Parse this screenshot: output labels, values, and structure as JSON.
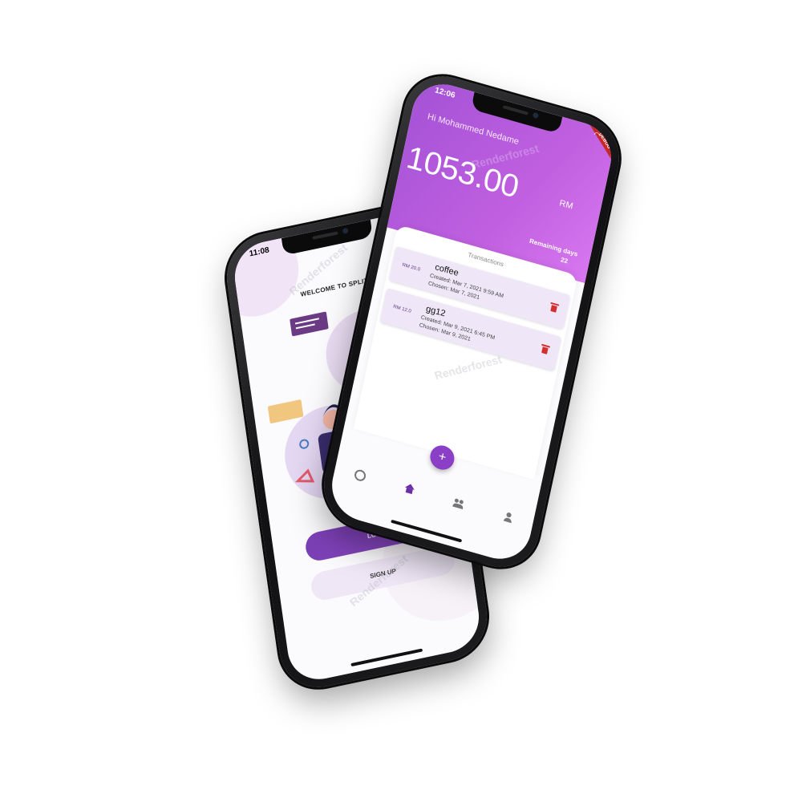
{
  "login_screen": {
    "status_time": "11:08",
    "title": "WELCOME TO SPLIT",
    "login_label": "LOGIN",
    "signup_label": "SIGN UP"
  },
  "home_screen": {
    "status_time": "12:06",
    "debug_label": "DEBUG",
    "greeting": "Hi Mohammed Nedame",
    "balance": "1053.00",
    "currency": "RM",
    "remaining_label": "Remaining days",
    "remaining_value": "22",
    "transactions_title": "Transactions",
    "transactions": [
      {
        "amount": "RM 20.0",
        "name": "coffee",
        "created": "Created: Mar 7, 2021 9:59 AM",
        "chosen": "Chosen:  Mar 7, 2021"
      },
      {
        "amount": "RM 12.0",
        "name": "gg12",
        "created": "Created: Mar 9, 2021 6:45 PM",
        "chosen": "Chosen:  Mar 9, 2021"
      }
    ],
    "fab_label": "+",
    "nav_items": [
      "chart-icon",
      "home-icon",
      "group-icon",
      "person-icon"
    ]
  },
  "watermark": "Renderforest",
  "colors": {
    "primary": "#8a3fc6",
    "header_start": "#a452d6",
    "header_end": "#d877f0",
    "card_bg": "#efe7f7",
    "delete": "#d32f2f"
  }
}
